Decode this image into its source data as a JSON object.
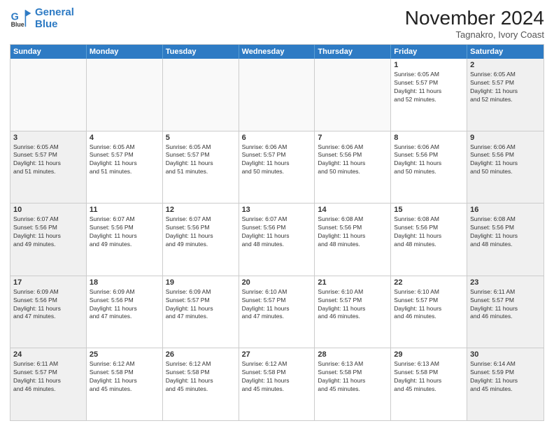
{
  "header": {
    "logo": {
      "line1": "General",
      "line2": "Blue"
    },
    "title": "November 2024",
    "location": "Tagnakro, Ivory Coast"
  },
  "weekdays": [
    "Sunday",
    "Monday",
    "Tuesday",
    "Wednesday",
    "Thursday",
    "Friday",
    "Saturday"
  ],
  "rows": [
    [
      {
        "day": "",
        "info": "",
        "empty": true
      },
      {
        "day": "",
        "info": "",
        "empty": true
      },
      {
        "day": "",
        "info": "",
        "empty": true
      },
      {
        "day": "",
        "info": "",
        "empty": true
      },
      {
        "day": "",
        "info": "",
        "empty": true
      },
      {
        "day": "1",
        "info": "Sunrise: 6:05 AM\nSunset: 5:57 PM\nDaylight: 11 hours\nand 52 minutes.",
        "empty": false
      },
      {
        "day": "2",
        "info": "Sunrise: 6:05 AM\nSunset: 5:57 PM\nDaylight: 11 hours\nand 52 minutes.",
        "empty": false,
        "shaded": true
      }
    ],
    [
      {
        "day": "3",
        "info": "Sunrise: 6:05 AM\nSunset: 5:57 PM\nDaylight: 11 hours\nand 51 minutes.",
        "empty": false,
        "shaded": true
      },
      {
        "day": "4",
        "info": "Sunrise: 6:05 AM\nSunset: 5:57 PM\nDaylight: 11 hours\nand 51 minutes.",
        "empty": false
      },
      {
        "day": "5",
        "info": "Sunrise: 6:05 AM\nSunset: 5:57 PM\nDaylight: 11 hours\nand 51 minutes.",
        "empty": false
      },
      {
        "day": "6",
        "info": "Sunrise: 6:06 AM\nSunset: 5:57 PM\nDaylight: 11 hours\nand 50 minutes.",
        "empty": false
      },
      {
        "day": "7",
        "info": "Sunrise: 6:06 AM\nSunset: 5:56 PM\nDaylight: 11 hours\nand 50 minutes.",
        "empty": false
      },
      {
        "day": "8",
        "info": "Sunrise: 6:06 AM\nSunset: 5:56 PM\nDaylight: 11 hours\nand 50 minutes.",
        "empty": false
      },
      {
        "day": "9",
        "info": "Sunrise: 6:06 AM\nSunset: 5:56 PM\nDaylight: 11 hours\nand 50 minutes.",
        "empty": false,
        "shaded": true
      }
    ],
    [
      {
        "day": "10",
        "info": "Sunrise: 6:07 AM\nSunset: 5:56 PM\nDaylight: 11 hours\nand 49 minutes.",
        "empty": false,
        "shaded": true
      },
      {
        "day": "11",
        "info": "Sunrise: 6:07 AM\nSunset: 5:56 PM\nDaylight: 11 hours\nand 49 minutes.",
        "empty": false
      },
      {
        "day": "12",
        "info": "Sunrise: 6:07 AM\nSunset: 5:56 PM\nDaylight: 11 hours\nand 49 minutes.",
        "empty": false
      },
      {
        "day": "13",
        "info": "Sunrise: 6:07 AM\nSunset: 5:56 PM\nDaylight: 11 hours\nand 48 minutes.",
        "empty": false
      },
      {
        "day": "14",
        "info": "Sunrise: 6:08 AM\nSunset: 5:56 PM\nDaylight: 11 hours\nand 48 minutes.",
        "empty": false
      },
      {
        "day": "15",
        "info": "Sunrise: 6:08 AM\nSunset: 5:56 PM\nDaylight: 11 hours\nand 48 minutes.",
        "empty": false
      },
      {
        "day": "16",
        "info": "Sunrise: 6:08 AM\nSunset: 5:56 PM\nDaylight: 11 hours\nand 48 minutes.",
        "empty": false,
        "shaded": true
      }
    ],
    [
      {
        "day": "17",
        "info": "Sunrise: 6:09 AM\nSunset: 5:56 PM\nDaylight: 11 hours\nand 47 minutes.",
        "empty": false,
        "shaded": true
      },
      {
        "day": "18",
        "info": "Sunrise: 6:09 AM\nSunset: 5:56 PM\nDaylight: 11 hours\nand 47 minutes.",
        "empty": false
      },
      {
        "day": "19",
        "info": "Sunrise: 6:09 AM\nSunset: 5:57 PM\nDaylight: 11 hours\nand 47 minutes.",
        "empty": false
      },
      {
        "day": "20",
        "info": "Sunrise: 6:10 AM\nSunset: 5:57 PM\nDaylight: 11 hours\nand 47 minutes.",
        "empty": false
      },
      {
        "day": "21",
        "info": "Sunrise: 6:10 AM\nSunset: 5:57 PM\nDaylight: 11 hours\nand 46 minutes.",
        "empty": false
      },
      {
        "day": "22",
        "info": "Sunrise: 6:10 AM\nSunset: 5:57 PM\nDaylight: 11 hours\nand 46 minutes.",
        "empty": false
      },
      {
        "day": "23",
        "info": "Sunrise: 6:11 AM\nSunset: 5:57 PM\nDaylight: 11 hours\nand 46 minutes.",
        "empty": false,
        "shaded": true
      }
    ],
    [
      {
        "day": "24",
        "info": "Sunrise: 6:11 AM\nSunset: 5:57 PM\nDaylight: 11 hours\nand 46 minutes.",
        "empty": false,
        "shaded": true
      },
      {
        "day": "25",
        "info": "Sunrise: 6:12 AM\nSunset: 5:58 PM\nDaylight: 11 hours\nand 45 minutes.",
        "empty": false
      },
      {
        "day": "26",
        "info": "Sunrise: 6:12 AM\nSunset: 5:58 PM\nDaylight: 11 hours\nand 45 minutes.",
        "empty": false
      },
      {
        "day": "27",
        "info": "Sunrise: 6:12 AM\nSunset: 5:58 PM\nDaylight: 11 hours\nand 45 minutes.",
        "empty": false
      },
      {
        "day": "28",
        "info": "Sunrise: 6:13 AM\nSunset: 5:58 PM\nDaylight: 11 hours\nand 45 minutes.",
        "empty": false
      },
      {
        "day": "29",
        "info": "Sunrise: 6:13 AM\nSunset: 5:58 PM\nDaylight: 11 hours\nand 45 minutes.",
        "empty": false
      },
      {
        "day": "30",
        "info": "Sunrise: 6:14 AM\nSunset: 5:59 PM\nDaylight: 11 hours\nand 45 minutes.",
        "empty": false,
        "shaded": true
      }
    ]
  ]
}
